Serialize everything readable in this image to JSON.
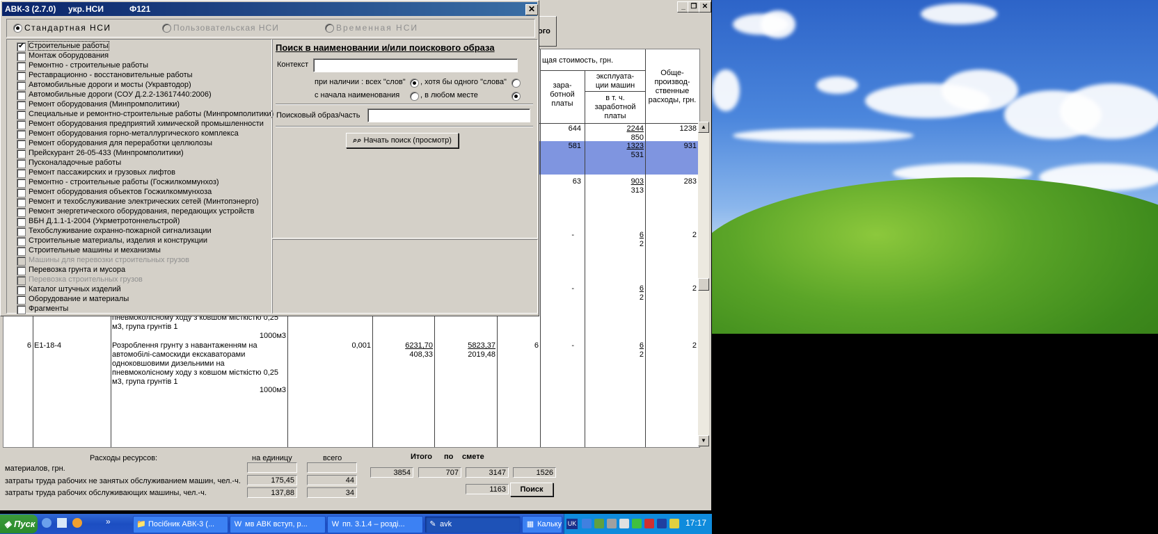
{
  "dialog": {
    "title_app": "АВК-3 (2.7.0)",
    "title_lang": "укр.",
    "title_nsi": "НСИ",
    "title_form": "Ф121",
    "close_glyph": "✕",
    "nsi_options": [
      {
        "label": "Стандартная НСИ",
        "selected": true,
        "enabled": true
      },
      {
        "label": "Пользовательская НСИ",
        "selected": false,
        "enabled": false
      },
      {
        "label": "Временная НСИ",
        "selected": false,
        "enabled": false
      }
    ],
    "categories": [
      {
        "label": "Строительные работы",
        "checked": true,
        "enabled": true
      },
      {
        "label": "Монтаж оборудования",
        "checked": false,
        "enabled": true
      },
      {
        "label": "Ремонтно - строительные работы",
        "checked": false,
        "enabled": true
      },
      {
        "label": "Реставрационно - восстановительные работы",
        "checked": false,
        "enabled": true
      },
      {
        "label": "Автомобильные дороги и мосты (Укравтодор)",
        "checked": false,
        "enabled": true
      },
      {
        "label": "Автомобильные дороги (СОУ Д.2.2-13617440:2006)",
        "checked": false,
        "enabled": true
      },
      {
        "label": "Ремонт оборудования (Минпромполитики)",
        "checked": false,
        "enabled": true
      },
      {
        "label": "Специальные и ремонтно-строительные работы (Минпромполитики)",
        "checked": false,
        "enabled": true
      },
      {
        "label": "Ремонт оборудования предприятий химической промышленности",
        "checked": false,
        "enabled": true
      },
      {
        "label": "Ремонт оборудования горно-металлургического комплекса",
        "checked": false,
        "enabled": true
      },
      {
        "label": "Ремонт оборудования для переработки целлюлозы",
        "checked": false,
        "enabled": true
      },
      {
        "label": "Прейскурант 26-05-433 (Минпромполитики)",
        "checked": false,
        "enabled": true
      },
      {
        "label": "Пусконаладочные работы",
        "checked": false,
        "enabled": true
      },
      {
        "label": "Ремонт пассажирских и грузовых лифтов",
        "checked": false,
        "enabled": true
      },
      {
        "label": "Ремонтно - строительные работы (Госжилкоммунхоз)",
        "checked": false,
        "enabled": true
      },
      {
        "label": "Ремонт оборудования объектов Госжилкоммунхоза",
        "checked": false,
        "enabled": true
      },
      {
        "label": "Ремонт и техобслуживание электрических сетей (Минтопэнерго)",
        "checked": false,
        "enabled": true
      },
      {
        "label": "Ремонт энергетического оборудования, передающих устройств",
        "checked": false,
        "enabled": true
      },
      {
        "label": "ВБН Д.1.1-1-2004 (Укрметротоннельстрой)",
        "checked": false,
        "enabled": true
      },
      {
        "label": "Техобслуживание охранно-пожарной сигнализации",
        "checked": false,
        "enabled": true
      },
      {
        "label": "Строительные материалы, изделия и конструкции",
        "checked": false,
        "enabled": true
      },
      {
        "label": "Строительные машины и механизмы",
        "checked": false,
        "enabled": true
      },
      {
        "label": "Машины для перевозки строительных грузов",
        "checked": false,
        "enabled": false
      },
      {
        "label": "Перевозка грунта и мусора",
        "checked": false,
        "enabled": true
      },
      {
        "label": "Перевозка строительных грузов",
        "checked": false,
        "enabled": false
      },
      {
        "label": "Каталог штучных изделий",
        "checked": false,
        "enabled": true
      },
      {
        "label": "Оборудование и материалы",
        "checked": false,
        "enabled": true
      },
      {
        "label": "Фрагменты",
        "checked": false,
        "enabled": true
      }
    ],
    "search": {
      "heading": "Поиск в наименовании и/или поискового образа",
      "context_label": "Контекст",
      "context_value": "",
      "presence_label": "при наличии : всех \"слов\"",
      "presence_all_selected": true,
      "any_word_label": ", хотя бы одного \"слова\"",
      "from_start_label": "с начала наименования",
      "anywhere_label": ", в любом месте",
      "anywhere_selected": true,
      "pattern_label": "Поисковый образ/часть",
      "pattern_value": "",
      "start_button": "Начать поиск (просмотр)"
    }
  },
  "main": {
    "toolbar_fragment": "ого",
    "header": {
      "total_cost": "щая стоимость, грн.",
      "salary": "зара-\nботной\nплаты",
      "machine_op": "эксплуата-\nции машин",
      "incl_salary": "в т. ч.\nзаработной\nплаты",
      "overhead": "Обще-\nпроизвод-\nственные\nрасходы, грн."
    },
    "rows": [
      {
        "salary": "644",
        "machine": "2244",
        "machine_sal": "850",
        "overhead": "1238",
        "selected": false
      },
      {
        "salary": "581",
        "machine": "1323",
        "machine_sal": "531",
        "overhead": "931",
        "selected": true
      },
      {
        "salary": "63",
        "machine": "903",
        "machine_sal": "313",
        "overhead": "283",
        "selected": false
      },
      {
        "salary": "-",
        "machine": "6",
        "machine_sal": "2",
        "overhead": "2",
        "selected": false
      },
      {
        "salary": "-",
        "machine": "6",
        "machine_sal": "2",
        "overhead": "2",
        "selected": false
      }
    ],
    "partial_text_top": "пневмоколісному ходу з ковшом місткістю 0,25\nм3, група грунтів 1",
    "partial_unit_top": "1000м3",
    "row6": {
      "num": "6",
      "code": "Е1-18-4",
      "desc": "Розроблення грунту з навантаженням на\nавтомобілі-самоскиди екскаваторами\nодноковшовими дизельними на\nпневмоколісному ходу з ковшом місткістю 0,25\nм3, група грунтів 1",
      "unit": "1000м3",
      "qty": "0,001",
      "cost_unit": "6231,70",
      "cost_unit_sal": "408,33",
      "cost_total": "5823,37",
      "cost_total_sal": "2019,48",
      "col_a": "6",
      "salary": "-",
      "machine": "6",
      "machine_sal": "2",
      "overhead": "2"
    }
  },
  "bottom": {
    "resources_label": "Расходы ресурсов:",
    "per_unit_label": "на единицу",
    "total_label": "всего",
    "itogo_label": "Итого",
    "po_label": "по",
    "smete_label": "смете",
    "materials_label": "материалов, грн.",
    "labor1_label": "затраты труда рабочих не занятых обслуживанием машин, чел.-ч.",
    "labor2_label": "затраты труда рабочих обслуживающих машины, чел.-ч.",
    "labor1_unit": "175,45",
    "labor1_total": "44",
    "labor2_unit": "137,88",
    "labor2_total": "34",
    "totals": [
      "3854",
      "707",
      "3147",
      "1526"
    ],
    "total_extra": "1163",
    "search_button": "Поиск"
  },
  "taskbar": {
    "start": "Пуск",
    "tasks": [
      {
        "label": "Посібник АВК-3 (...",
        "active": false
      },
      {
        "label": "мв АВК вступ, р...",
        "active": false
      },
      {
        "label": "пп. 3.1.4 – розді...",
        "active": false
      },
      {
        "label": "avk",
        "active": true
      },
      {
        "label": "Калькулятор Плюс",
        "active": false
      }
    ],
    "lang": "UK",
    "clock": "17:17"
  }
}
